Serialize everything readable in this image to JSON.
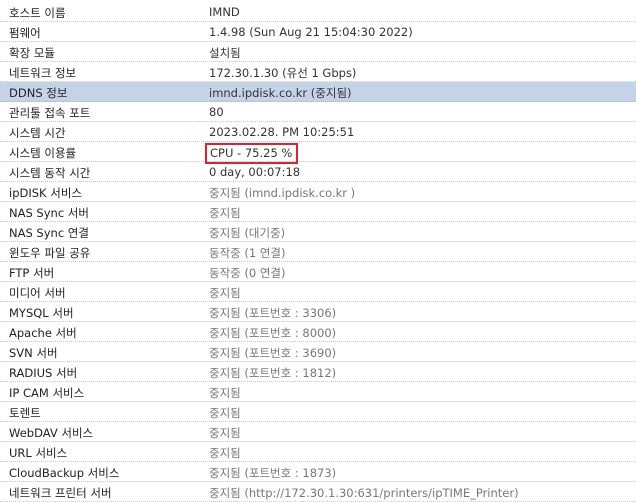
{
  "rows": [
    {
      "label": "호스트 이름",
      "value": "IMND"
    },
    {
      "label": "펌웨어",
      "value": "1.4.98 (Sun Aug 21 15:04:30 2022)"
    },
    {
      "label": "확장 모듈",
      "value": "설치됨"
    },
    {
      "label": "네트워크 정보",
      "value": "172.30.1.30 (유선 1 Gbps)"
    },
    {
      "label": "DDNS 정보",
      "value": "imnd.ipdisk.co.kr (중지됨)"
    },
    {
      "label": "관리툴 접속 포트",
      "value": "80"
    },
    {
      "label": "시스템 시간",
      "value": "2023.02.28. PM 10:25:51"
    },
    {
      "label": "시스템 이용률",
      "value": "CPU - 75.25 %"
    },
    {
      "label": "시스템 동작 시간",
      "value": "0 day, 00:07:18"
    },
    {
      "label": "ipDISK 서비스",
      "value": "중지됨 (imnd.ipdisk.co.kr )"
    },
    {
      "label": "NAS Sync 서버",
      "value": "중지됨"
    },
    {
      "label": "NAS Sync 연결",
      "value": "중지됨 (대기중)"
    },
    {
      "label": "윈도우 파일 공유",
      "value": "동작중 (1 연결)"
    },
    {
      "label": "FTP 서버",
      "value": "동작중 (0 연결)"
    },
    {
      "label": "미디어 서버",
      "value": "중지됨"
    },
    {
      "label": "MYSQL 서버",
      "value": "중지됨 (포트번호 : 3306)"
    },
    {
      "label": "Apache 서버",
      "value": "중지됨 (포트번호 : 8000)"
    },
    {
      "label": "SVN 서버",
      "value": "중지됨 (포트번호 : 3690)"
    },
    {
      "label": "RADIUS 서버",
      "value": "중지됨 (포트번호 : 1812)"
    },
    {
      "label": "IP CAM 서비스",
      "value": "중지됨"
    },
    {
      "label": "토렌트",
      "value": "중지됨"
    },
    {
      "label": "WebDAV 서비스",
      "value": "중지됨"
    },
    {
      "label": "URL 서비스",
      "value": "중지됨"
    },
    {
      "label": "CloudBackup 서비스",
      "value": "중지됨 (포트번호 : 1873)"
    },
    {
      "label": "네트워크 프린터 서버",
      "value": "중지됨 (http://172.30.1.30:631/printers/ipTIME_Printer)"
    }
  ],
  "colors": {
    "highlight_row": "#c5d3e8",
    "cpu_box_border": "#e0222a"
  }
}
